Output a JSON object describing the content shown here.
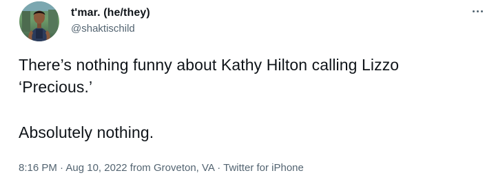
{
  "user": {
    "display_name": "t'mar. (he/they)",
    "handle": "@shaktischild",
    "avatar_icon": "profile-photo"
  },
  "menu": {
    "icon": "more-horizontal-icon"
  },
  "tweet": {
    "paragraph_1": "There’s nothing funny about Kathy Hilton calling Lizzo ‘Precious.’",
    "paragraph_2": "Absolutely nothing."
  },
  "meta": {
    "time": "8:16 PM",
    "separator": " · ",
    "date_location": "Aug 10, 2022 from Groveton, VA",
    "source": "Twitter for iPhone"
  },
  "colors": {
    "text_primary": "#0f1419",
    "text_secondary": "#536471",
    "background": "#ffffff"
  }
}
